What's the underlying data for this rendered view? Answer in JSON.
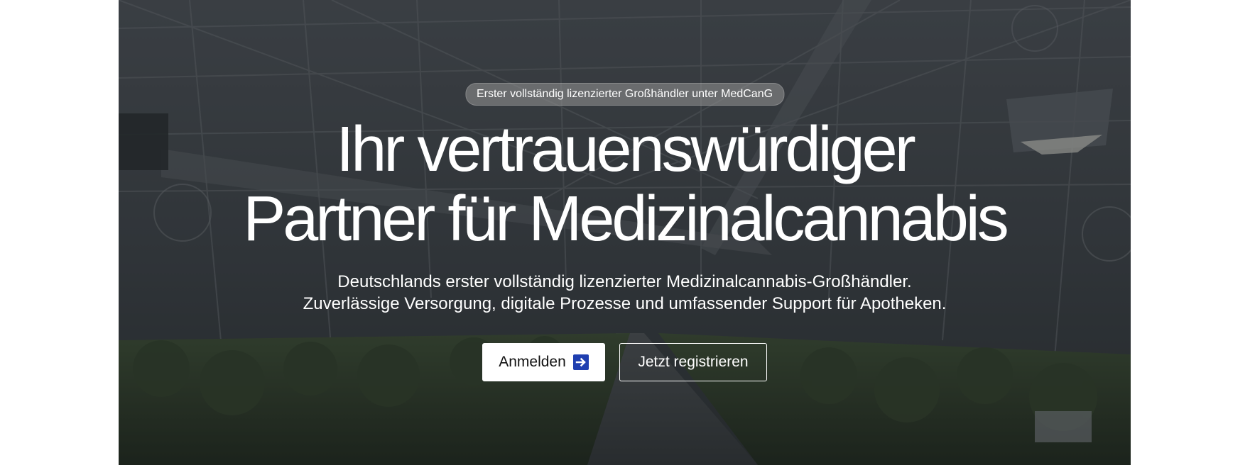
{
  "hero": {
    "badge": "Erster vollständig lizenzierter Großhändler unter MedCanG",
    "headline_line1": "Ihr vertrauenswürdiger",
    "headline_line2": "Partner für Medizinalcannabis",
    "subtext_line1": "Deutschlands erster vollständig lizenzierter Medizinalcannabis-Großhändler.",
    "subtext_line2": "Zuverlässige Versorgung, digitale Prozesse und umfassender Support für Apotheken."
  },
  "actions": {
    "login_label": "Anmelden",
    "login_icon": "arrow-right-icon",
    "register_label": "Jetzt registrieren"
  },
  "colors": {
    "overlay": "#2b2f33",
    "button_accent": "#1f3fb0",
    "text": "#ffffff"
  }
}
